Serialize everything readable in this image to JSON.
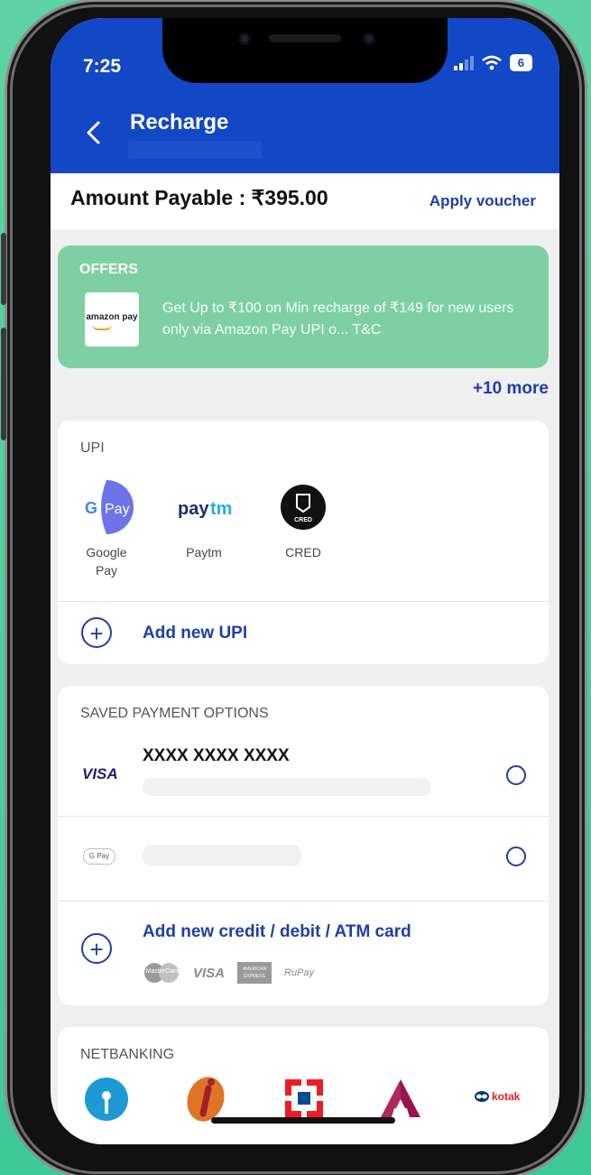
{
  "status": {
    "time": "7:25",
    "battery": "6"
  },
  "header": {
    "title": "Recharge"
  },
  "amount": {
    "label": "Amount Payable : ₹395.00",
    "apply_voucher": "Apply voucher"
  },
  "offers": {
    "title": "OFFERS",
    "logo_text": "amazon pay",
    "text": "Get Up to ₹100 on Min recharge of ₹149 for new users only via Amazon Pay UPI o... T&C",
    "more": "+10 more"
  },
  "upi": {
    "title": "UPI",
    "apps": [
      {
        "name_line1": "Google",
        "name_line2": "Pay",
        "logo_text": "G Pay"
      },
      {
        "name_line1": "Paytm",
        "name_line2": "",
        "logo_text": "Paytm"
      },
      {
        "name_line1": "CRED",
        "name_line2": "",
        "logo_text": "CRED"
      }
    ],
    "add_new": "Add new UPI"
  },
  "saved": {
    "title": "SAVED PAYMENT OPTIONS",
    "items": [
      {
        "brand": "VISA",
        "number": "XXXX XXXX XXXX"
      },
      {
        "brand": "G Pay"
      }
    ],
    "add_card": "Add new credit / debit / ATM card",
    "networks": [
      "MasterCard",
      "VISA",
      "AMERICAN EXPRESS",
      "RuPay"
    ]
  },
  "netbanking": {
    "title": "NETBANKING",
    "banks": [
      "SBI",
      "ICICI",
      "HDFC",
      "Axis",
      "kotak"
    ]
  },
  "colors": {
    "primary": "#1247c6",
    "link": "#1d3fa8",
    "offer_bg": "#7ed0a3",
    "background": "#5ed3a4"
  }
}
